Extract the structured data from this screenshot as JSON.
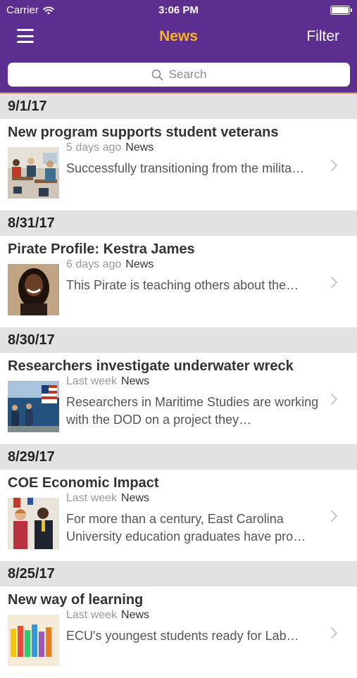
{
  "status": {
    "carrier": "Carrier",
    "time": "3:06 PM"
  },
  "nav": {
    "title": "News",
    "filter": "Filter"
  },
  "search": {
    "placeholder": "Search"
  },
  "colors": {
    "nav_bg": "#5b2e8f",
    "title_gold": "#f7b51f"
  },
  "sections": [
    {
      "date": "9/1/17",
      "title": "New program supports student veterans",
      "ago": "5 days ago",
      "category": "News",
      "description": "Successfully transitioning from the milita…"
    },
    {
      "date": "8/31/17",
      "title": "Pirate Profile: Kestra James",
      "ago": "6 days ago",
      "category": "News",
      "description": "This Pirate is teaching others about the…"
    },
    {
      "date": "8/30/17",
      "title": "Researchers investigate underwater wreck",
      "ago": "Last week",
      "category": "News",
      "description": "Researchers in Maritime Studies are working with the DOD on a project they…"
    },
    {
      "date": "8/29/17",
      "title": "COE Economic Impact",
      "ago": "Last week",
      "category": "News",
      "description": "For more than a century, East Carolina University education graduates have pro…"
    },
    {
      "date": "8/25/17",
      "title": "New way of learning",
      "ago": "Last week",
      "category": "News",
      "description": "ECU's youngest students ready for Lab…"
    }
  ]
}
